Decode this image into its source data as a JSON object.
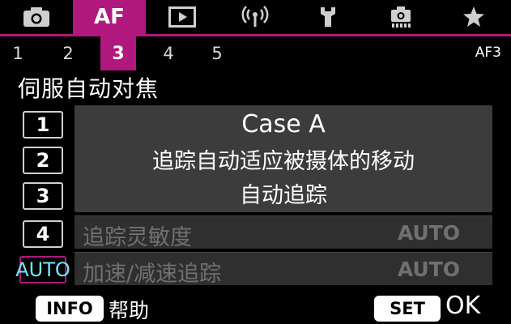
{
  "tabs": [
    {
      "icon": "camera-icon",
      "label": ""
    },
    {
      "icon": "af-tab",
      "label": "AF"
    },
    {
      "icon": "playback-icon",
      "label": ""
    },
    {
      "icon": "wireless-icon",
      "label": ""
    },
    {
      "icon": "wrench-icon",
      "label": ""
    },
    {
      "icon": "custom-function-camera-icon",
      "label": ""
    },
    {
      "icon": "star-icon",
      "label": ""
    }
  ],
  "active_tab": "AF",
  "subtabs": [
    "1",
    "2",
    "3",
    "4",
    "5"
  ],
  "active_subtab": "3",
  "page_code": "AF3",
  "page_title": "伺服自动对焦",
  "cases": [
    "1",
    "2",
    "3",
    "4",
    "AUTO"
  ],
  "selected_case": "AUTO",
  "description": {
    "title": "Case A",
    "main": "追踪自动适应被摄体的移动",
    "sub": "自动追踪"
  },
  "params": [
    {
      "label": "追踪灵敏度",
      "value": "AUTO"
    },
    {
      "label": "加速/减速追踪",
      "value": "AUTO"
    }
  ],
  "footer": {
    "info_button": "INFO",
    "info_label": "帮助",
    "set_button": "SET",
    "ok_label": "OK"
  },
  "colors": {
    "accent": "#b0187e",
    "auto_text": "#6fe6ff",
    "desc_bg": "#3c3c3c",
    "dimmed_text": "#707070"
  }
}
